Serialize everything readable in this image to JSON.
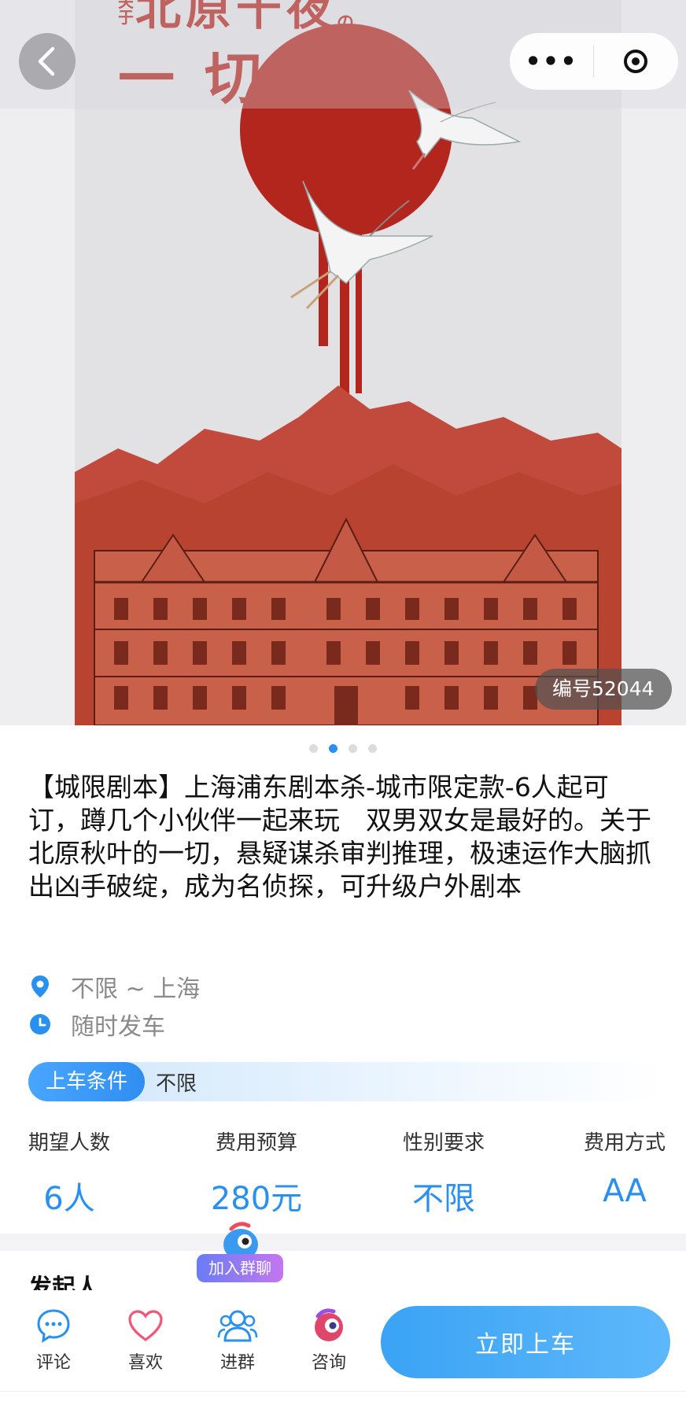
{
  "nav": {
    "back_icon": "chevron-left-icon",
    "more_label": "•••",
    "close_icon": "target-icon"
  },
  "poster": {
    "title_prefix": "关于",
    "title_main": "北原千夜",
    "title_suffix": "の",
    "title_line2": "一切"
  },
  "listing": {
    "id_badge": "编号52044",
    "carousel_count": 4,
    "carousel_active": 2,
    "title": "【城限剧本】上海浦东剧本杀-城市限定款-6人起可订，蹲几个小伙伴一起来玩　双男双女是最好的。关于北原秋叶的一切，悬疑谋杀审判推理，极速运作大脑抓出凶手破绽，成为名侦探，可升级户外剧本",
    "location": "不限 ~ 上海",
    "time": "随时发车",
    "condition_label": "上车条件",
    "condition_value": "不限"
  },
  "stats": [
    {
      "label": "期望人数",
      "value": "6人"
    },
    {
      "label": "费用预算",
      "value": "280元"
    },
    {
      "label": "性别要求",
      "value": "不限"
    },
    {
      "label": "费用方式",
      "value": "AA"
    }
  ],
  "section": {
    "initiator_title": "发起人"
  },
  "join_bubble": {
    "label": "加入群聊"
  },
  "bottom_bar": {
    "tabs": [
      {
        "label": "评论",
        "icon": "comment-icon"
      },
      {
        "label": "喜欢",
        "icon": "heart-icon"
      },
      {
        "label": "进群",
        "icon": "group-icon"
      },
      {
        "label": "咨询",
        "icon": "consult-icon"
      }
    ],
    "cta_label": "立即上车"
  },
  "colors": {
    "accent": "#2a90ef",
    "poster_red": "#b3261e"
  }
}
